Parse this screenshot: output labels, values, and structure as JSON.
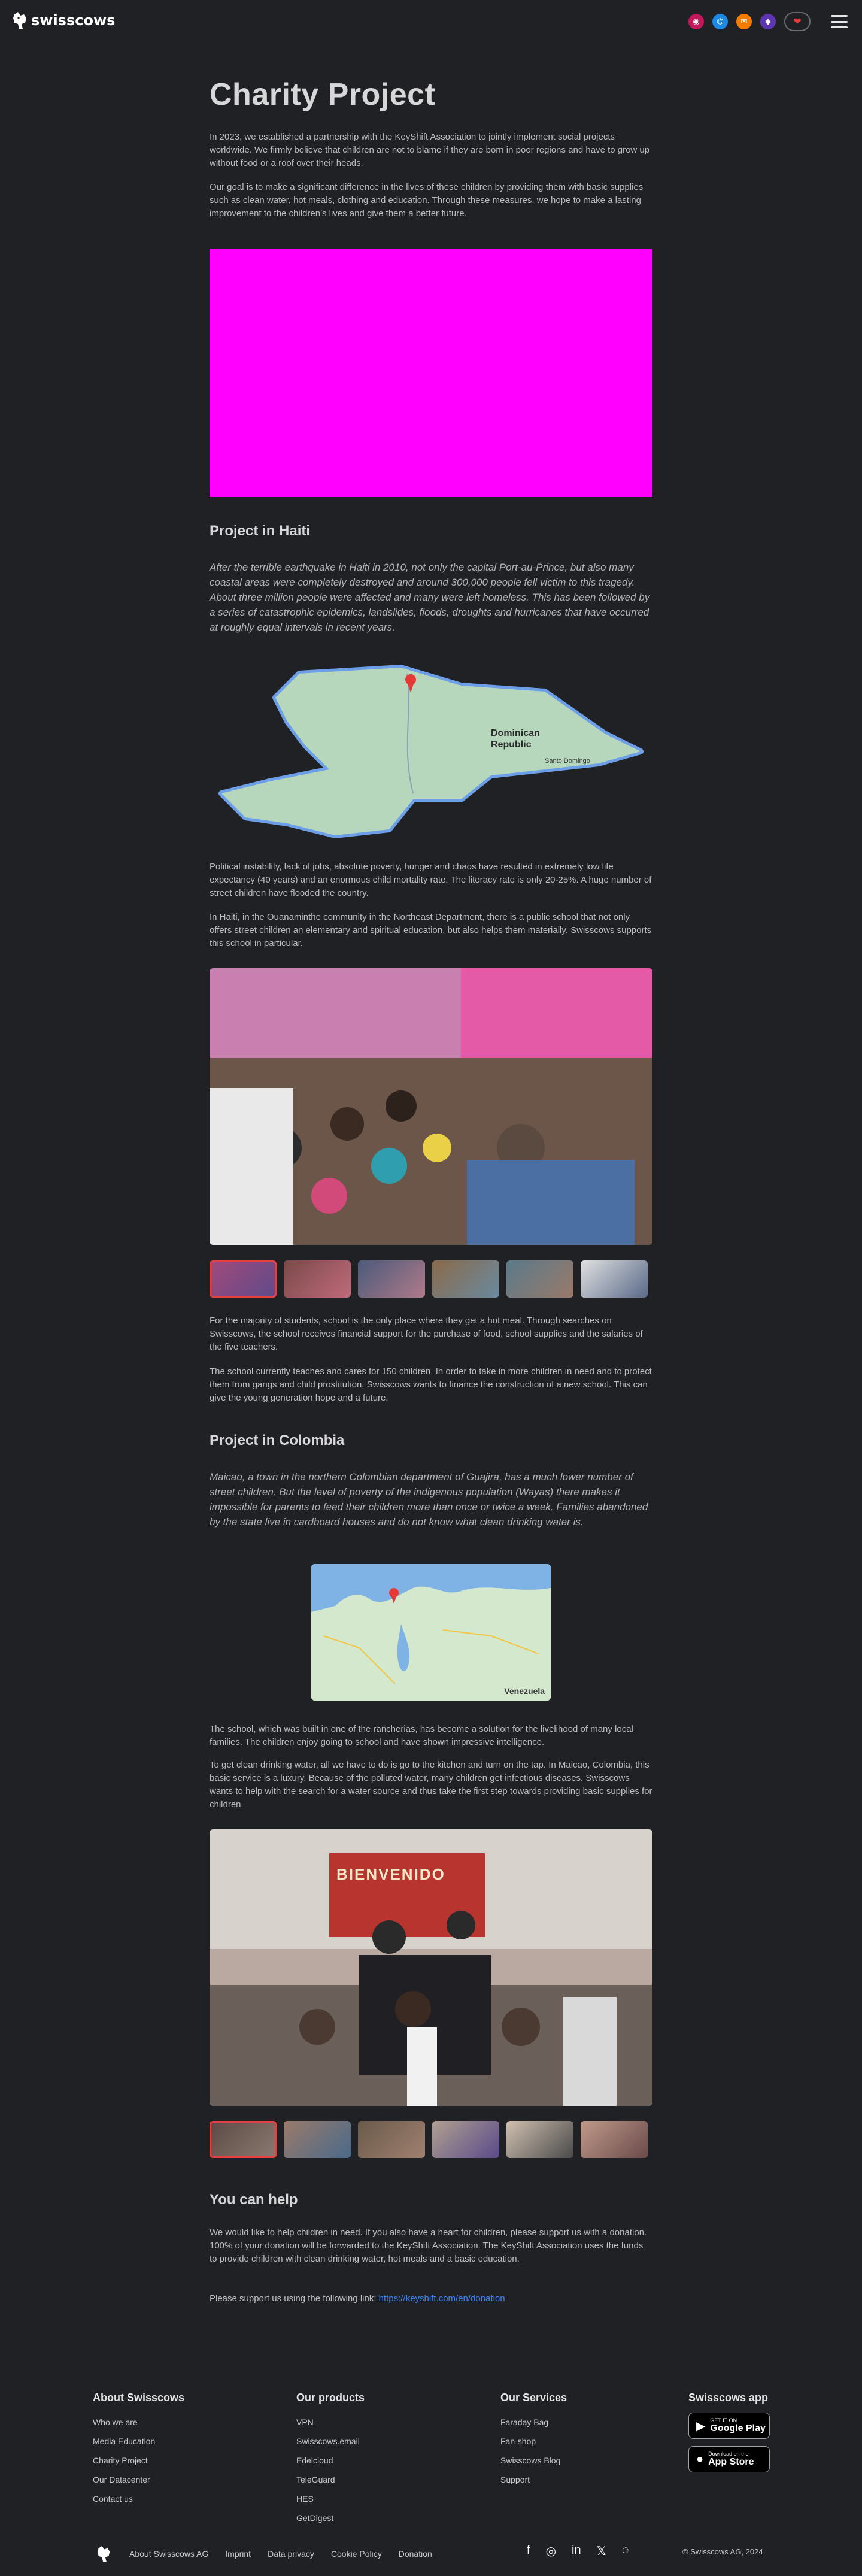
{
  "header": {
    "logo_text": "swisscows",
    "icons": [
      "vpn-icon",
      "teleguard-icon",
      "mail-icon",
      "hes-icon"
    ],
    "heart_label": "❤"
  },
  "page": {
    "title": "Charity Project",
    "intro_paragraphs": [
      "In 2023, we established a partnership with the KeyShift Association to jointly implement social projects worldwide. We firmly believe that children are not to blame if they are born in poor regions and have to grow up without food or a roof over their heads.",
      "Our goal is to make a significant difference in the lives of these children by providing them with basic supplies such as clean water, hot meals, clothing and education. Through these measures, we hope to make a lasting improvement to the children's lives and give them a better future."
    ]
  },
  "haiti": {
    "heading": "Project in Haiti",
    "lead": "After the terrible earthquake in Haiti in 2010, not only the capital Port-au-Prince, but also many coastal areas were completely destroyed and around 300,000 people fell victim to this tragedy. About three million people were affected and many were left homeless. This has been followed by a series of catastrophic epidemics, landslides, floods, droughts and hurricanes that have occurred at roughly equal intervals in recent years.",
    "map_label": "Dominican Republic",
    "map_city": "Santo Domingo",
    "paragraphs": [
      "Political instability, lack of jobs, absolute poverty, hunger and chaos have resulted in extremely low life expectancy (40 years) and an enormous child mortality rate. The literacy rate is only 20-25%. A huge number of street children have flooded the country.",
      "In Haiti, in the Ouanaminthe community in the Northeast Department, there is a public school that not only offers street children an elementary and spiritual education, but also helps them materially. Swisscows supports this school in particular."
    ],
    "paragraphs_after": [
      "For the majority of students, school is the only place where they get a hot meal. Through searches on Swisscows, the school receives financial support for the purchase of food, school supplies and the salaries of the five teachers.",
      "The school currently teaches and cares for 150 children. In order to take in more children in need and to protect them from gangs and child prostitution, Swisscows wants to finance the construction of a new school. This can give the young generation hope and a future."
    ]
  },
  "colombia": {
    "heading": "Project in Colombia",
    "lead": "Maicao, a town in the northern Colombian department of Guajira, has a much lower number of street children. But the level of poverty of the indigenous population (Wayas) there makes it impossible for parents to feed their children more than once or twice a week. Families abandoned by the state live in cardboard houses and do not know what clean drinking water is.",
    "map_label": "Venezuela",
    "paragraphs": [
      "The school, which was built in one of the rancherias, has become a solution for the livelihood of many local families. The children enjoy going to school and have shown impressive intelligence.",
      "To get clean drinking water, all we have to do is go to the kitchen and turn on the tap. In Maicao, Colombia, this basic service is a luxury. Because of the polluted water, many children get infectious diseases. Swisscows wants to help with the search for a water source and thus take the first step towards providing basic supplies for children."
    ],
    "photo_banner": "BIENVENIDO"
  },
  "help": {
    "heading": "You can help",
    "paragraph": "We would like to help children in need. If you also have a heart for children, please support us with a donation. 100% of your donation will be forwarded to the KeyShift Association. The KeyShift Association uses the funds to provide children with clean drinking water, hot meals and a basic education.",
    "link_prefix": "Please support us using the following link: ",
    "link_text": "https://keyshift.com/en/donation"
  },
  "footer": {
    "about": {
      "title": "About Swisscows",
      "items": [
        "Who we are",
        "Media Education",
        "Charity Project",
        "Our Datacenter",
        "Contact us"
      ]
    },
    "products": {
      "title": "Our products",
      "items": [
        "VPN",
        "Swisscows.email",
        "Edelcloud",
        "TeleGuard",
        "HES",
        "GetDigest"
      ]
    },
    "services": {
      "title": "Our Services",
      "items": [
        "Faraday Bag",
        "Fan-shop",
        "Swisscows Blog",
        "Support"
      ]
    },
    "app": {
      "title": "Swisscows app",
      "google_small": "GET IT ON",
      "google_big": "Google Play",
      "apple_small": "Download on the",
      "apple_big": "App Store"
    },
    "bottom_links": [
      "About Swisscows AG",
      "Imprint",
      "Data privacy",
      "Cookie Policy",
      "Donation"
    ],
    "social_icons": [
      "facebook-icon",
      "instagram-icon",
      "linkedin-icon",
      "x-icon",
      "teleguard-icon"
    ],
    "copyright": "© Swisscows AG, 2024"
  },
  "colors": {
    "background": "#202124",
    "accent": "#e2413f",
    "link": "#3b82f6",
    "video_placeholder": "#ff00ff"
  }
}
